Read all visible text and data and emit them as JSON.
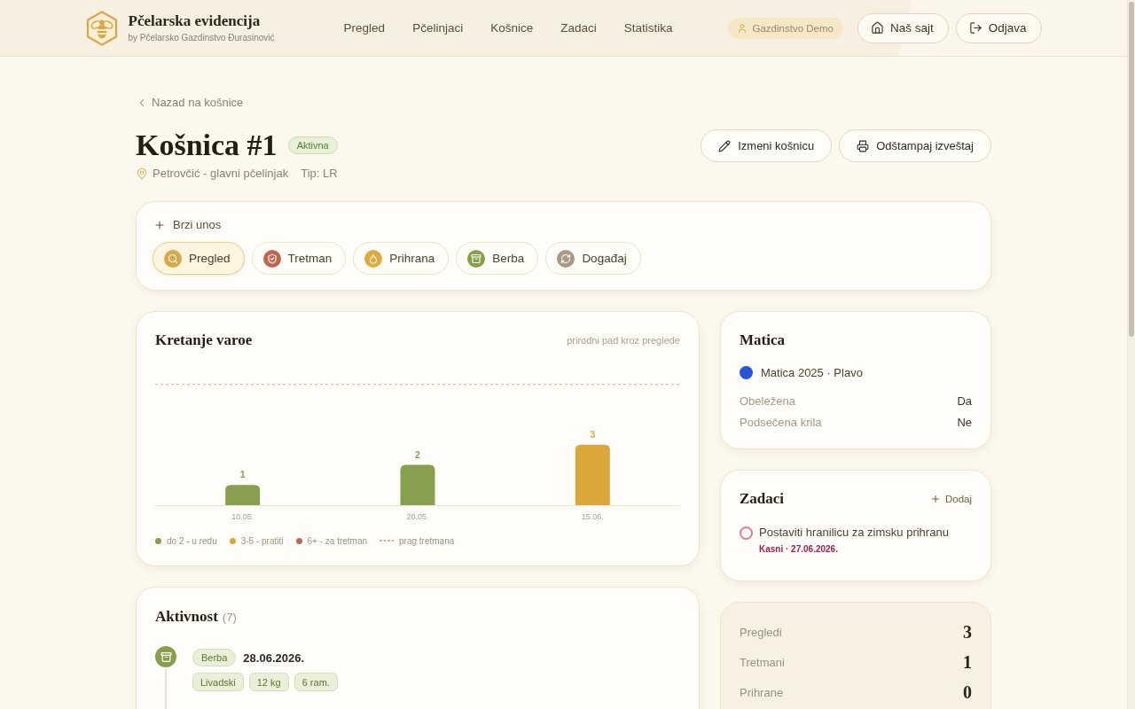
{
  "header": {
    "brand": {
      "title": "Pčelarska evidencija",
      "subtitle": "by Pčelarsko Gazdinstvo Đurasinović"
    },
    "nav": [
      {
        "label": "Pregled",
        "selected": false
      },
      {
        "label": "Pčelinjaci",
        "selected": false
      },
      {
        "label": "Košnice",
        "selected": false
      },
      {
        "label": "Zadaci",
        "selected": false
      },
      {
        "label": "Statistika",
        "selected": false
      }
    ],
    "account": "Gazdinstvo Demo",
    "buttons": [
      {
        "label": "Naš sajt",
        "kind": "site"
      },
      {
        "label": "Odjava",
        "kind": "logout"
      }
    ]
  },
  "back_link": "Nazad na košnice",
  "hive": {
    "title": "Košnica #1",
    "status": {
      "label": "Aktivna",
      "kind": "active"
    },
    "location": "Petrovčić - glavni pčelinjak",
    "type": "Tip: LR"
  },
  "actions": [
    {
      "label": "Izmeni košnicu",
      "kind": "edit"
    },
    {
      "label": "Odštampaj izveštaj",
      "kind": "print"
    }
  ],
  "quick_entry": {
    "title": "Brzi unos",
    "items": [
      {
        "label": "Pregled",
        "kind": "inspection",
        "color": "#d6a94a",
        "selected": true
      },
      {
        "label": "Tretman",
        "kind": "treatment",
        "color": "#c0664f",
        "selected": false
      },
      {
        "label": "Prihrana",
        "kind": "feeding",
        "color": "#dfa93c",
        "selected": false
      },
      {
        "label": "Berba",
        "kind": "harvest",
        "color": "#88a04e",
        "selected": false
      },
      {
        "label": "Događaj",
        "kind": "event",
        "color": "#a89b86",
        "selected": false
      }
    ]
  },
  "varroa": {
    "caption": "prirodni pad kroz preglede",
    "chart_data": {
      "type": "bar",
      "title": "Kretanje varoe",
      "categories": [
        "10.05.",
        "28.05.",
        "15.06."
      ],
      "series": [
        {
          "name": "do 2 - u redu",
          "color": "#88a04e",
          "values": [
            1,
            2,
            null
          ]
        },
        {
          "name": "3-5 - pratiti",
          "color": "#dca73a",
          "values": [
            null,
            null,
            3
          ]
        },
        {
          "name": "6+ - za tretman",
          "color": "#b86a55",
          "values": [
            null,
            null,
            null
          ]
        }
      ],
      "stacked": true,
      "data_labels": true,
      "legend": "bottom",
      "ref_lines": [
        {
          "axis": "y",
          "value": 6,
          "label": "prag tretmana"
        }
      ]
    }
  },
  "queen": {
    "title": "Matica",
    "name": "Matica 2025 · Plavo",
    "color": "#2456d6",
    "rows": [
      {
        "label": "Obeležena",
        "value": "Da"
      },
      {
        "label": "Podsečena krila",
        "value": "Ne"
      }
    ]
  },
  "tasks": {
    "title": "Zadaci",
    "add": "Dodaj",
    "items": [
      {
        "title": "Postaviti hranilicu za zimsku prihranu",
        "due": "Kasni · 27.06.2026.",
        "checked": false,
        "overdue": true
      }
    ]
  },
  "stats": [
    {
      "label": "Pregledi",
      "value": "3"
    },
    {
      "label": "Tretmani",
      "value": "1"
    },
    {
      "label": "Prihrane",
      "value": "0"
    }
  ],
  "activity": {
    "title": "Aktivnost",
    "count": "(7)",
    "items": [
      {
        "kind": "harvest",
        "color": "#88a04e",
        "type_label": "Berba",
        "date": "28.06.2026.",
        "tags": [
          "Livadski",
          "12 kg",
          "6 ram."
        ]
      }
    ]
  }
}
